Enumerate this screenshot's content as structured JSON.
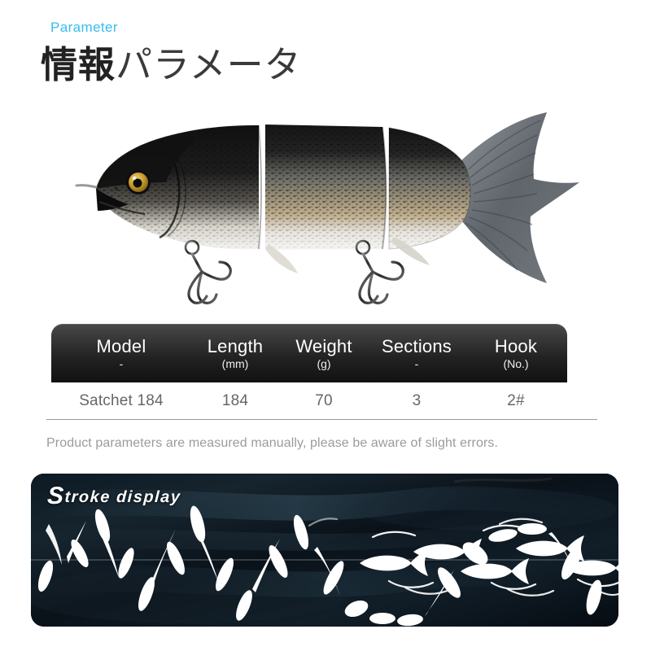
{
  "header": {
    "eyebrow": "Parameter",
    "title_kanji": "情報",
    "title_kana": "パラメータ",
    "accent_color": "#35bdee"
  },
  "product_image": {
    "name": "swimbait-lure",
    "description": "Three-section jointed hard swimbait fishing lure with treble hooks",
    "body_dark_color": "#1c1c1c",
    "belly_color": "#f2f0ec",
    "tail_color": "#6e7378",
    "eye_color": "#c8a23a"
  },
  "spec_table": {
    "columns": [
      {
        "title": "Model",
        "unit": "-"
      },
      {
        "title": "Length",
        "unit": "(mm)"
      },
      {
        "title": "Weight",
        "unit": "(g)"
      },
      {
        "title": "Sections",
        "unit": "-"
      },
      {
        "title": "Hook",
        "unit": "(No.)"
      }
    ],
    "rows": [
      {
        "model": "Satchet 184",
        "length": "184",
        "weight": "70",
        "sections": "3",
        "hook": "2#"
      }
    ]
  },
  "note": "Product parameters are measured manually, please be aware of slight errors.",
  "stroke_display": {
    "label_initial": "S",
    "label_rest": "troke display",
    "panel_color": "#0b1620",
    "silhouette_color": "#ffffff",
    "description": "White lure silhouettes tracing an S-curve swimming path over dark water"
  }
}
